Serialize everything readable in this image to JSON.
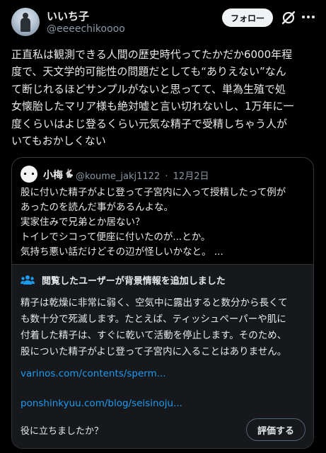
{
  "author": {
    "name": "いいち子",
    "handle": "@eeeechikoooo"
  },
  "header": {
    "follow_label": "フォロー",
    "icons": [
      "avatar",
      "grok-icon",
      "more-icon"
    ]
  },
  "tweet": {
    "text_lines": [
      "正直私は観測できる人間の歴史時代ってたかだか6000年程",
      "度で、天文学的可能性の問題だとしても“ありえない”なん",
      "て断じれるほどサンプルがないと思ってて、単為生殖で処",
      "女懐胎したマリア様も絶対嘘と言い切れないし、1万年に一",
      "度くらいはよじ登るくらい元気な精子で受精しちゃう人が",
      "いてもおかしくない"
    ]
  },
  "quote": {
    "name": "小梅",
    "badge": "🐇",
    "handle": "@koume_jakj1122",
    "separator": "·",
    "date": "12月2日",
    "text_lines": [
      "股に付いた精子がよじ登って子宮内に入って授精したって例が",
      "あったのを読んだ事があるんよな。",
      "実家住みで兄弟とか居ない？",
      "トイレでシコって便座に付いたのが...とか。",
      "気持ち悪い話だけどその辺が怪しいかなと。 ..."
    ]
  },
  "community_note": {
    "title": "閲覧したユーザーが背景情報を追加しました",
    "body_lines": [
      "精子は乾燥に非常に弱く、空気中に露出すると数分から長くて",
      "も数十分で死滅します。たとえば、ティッシュペーパーや肌に",
      "付着した精子は、すぐに乾いて活動を停止します。そのため、",
      "股についた精子がよじ登って子宮内に入ることはありません。"
    ],
    "links": [
      "varinos.com/contents/sperm...",
      "ponshinkyuu.com/blog/seisinoju..."
    ],
    "helpful_question": "役に立ちましたか？",
    "rate_label": "評価する"
  },
  "colors": {
    "background": "#000000",
    "text": "#e7e9ea",
    "secondary_text": "#8b98a5",
    "link": "#1d9bf0",
    "note_background": "#16181c",
    "border": "#333639"
  }
}
